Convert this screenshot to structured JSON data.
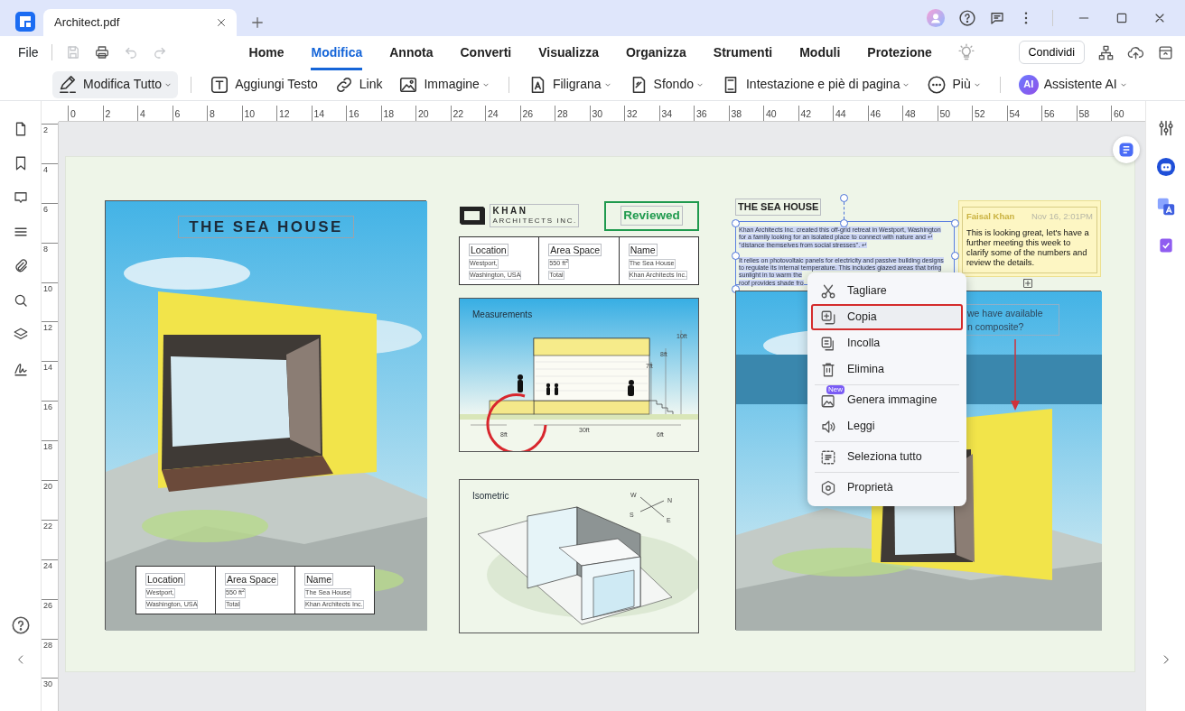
{
  "window": {
    "tab_title": "Architect.pdf"
  },
  "menu_bar": {
    "file": "File",
    "quick_actions": [
      {
        "disabled": true
      },
      {
        "disabled": false
      },
      {
        "disabled": true
      },
      {
        "disabled": true
      }
    ],
    "tabs": [
      {
        "label": "Home",
        "selected": false
      },
      {
        "label": "Modifica",
        "selected": true
      },
      {
        "label": "Annota",
        "selected": false
      },
      {
        "label": "Converti",
        "selected": false
      },
      {
        "label": "Visualizza",
        "selected": false
      },
      {
        "label": "Organizza",
        "selected": false
      },
      {
        "label": "Strumenti",
        "selected": false
      },
      {
        "label": "Moduli",
        "selected": false
      },
      {
        "label": "Protezione",
        "selected": false
      }
    ],
    "share_button": "Condividi"
  },
  "toolbar": [
    {
      "label": "Modifica Tutto",
      "dropdown": true,
      "selected": true,
      "separator_after": true
    },
    {
      "label": "Aggiungi Testo",
      "dropdown": false,
      "selected": false,
      "separator_after": false
    },
    {
      "label": "Link",
      "dropdown": false,
      "selected": false,
      "separator_after": false
    },
    {
      "label": "Immagine",
      "dropdown": true,
      "selected": false,
      "separator_after": true
    },
    {
      "label": "Filigrana",
      "dropdown": true,
      "selected": false,
      "separator_after": false
    },
    {
      "label": "Sfondo",
      "dropdown": true,
      "selected": false,
      "separator_after": false
    },
    {
      "label": "Intestazione e piè di pagina",
      "dropdown": true,
      "selected": false,
      "separator_after": false
    },
    {
      "label": "Più",
      "dropdown": true,
      "selected": false,
      "separator_after": true
    },
    {
      "label": "Assistente AI",
      "dropdown": true,
      "selected": false,
      "separator_after": false,
      "badge": "AI"
    }
  ],
  "ruler": {
    "horizontal": [
      "0",
      "2",
      "4",
      "6",
      "8",
      "10",
      "12",
      "14",
      "16",
      "18",
      "20",
      "22",
      "24",
      "26",
      "28",
      "30",
      "32",
      "34",
      "36",
      "38",
      "40",
      "42",
      "44",
      "46",
      "48",
      "50",
      "52",
      "54",
      "56",
      "58",
      "60"
    ],
    "vertical": [
      "2",
      "4",
      "6",
      "8",
      "10",
      "12",
      "14",
      "16",
      "18",
      "20",
      "22",
      "24",
      "26",
      "28",
      "30"
    ]
  },
  "document": {
    "left_panel": {
      "title": "THE SEA HOUSE",
      "info": [
        {
          "label": "Location",
          "lines": [
            "Westport,",
            "Washington, USA"
          ]
        },
        {
          "label": "Area Space",
          "lines": [
            "550 ft$^{2}$",
            "Total"
          ]
        },
        {
          "label": "Name",
          "lines": [
            "The Sea House",
            "Khan Architects Inc."
          ]
        }
      ]
    },
    "logo": {
      "name": "KHAN",
      "subtitle": "ARCHITECTS INC."
    },
    "stamp": "Reviewed",
    "info": [
      {
        "label": "Location",
        "lines": [
          "Westport,",
          "Washington, USA"
        ]
      },
      {
        "label": "Area Space",
        "lines": [
          "550 ft$^{2}$",
          "Total"
        ]
      },
      {
        "label": "Name",
        "lines": [
          "The Sea House",
          "Khan Architects Inc."
        ]
      }
    ],
    "measurements": {
      "title": "Measurements",
      "labels": [
        "10ft",
        "8ft",
        "7ft",
        "8ft",
        "30ft",
        "6ft"
      ]
    },
    "isometric": {
      "title": "Isometric",
      "compass": [
        "W",
        "N",
        "S",
        "E"
      ]
    },
    "right_panel": {
      "title": "THE SEA HOUSE",
      "paragraphs": [
        [
          "Khan Architects Inc. created this off-grid retreat in Westport, Washington",
          "for a family looking for an isolated place to connect with nature and ↵",
          "\"distance themselves from social stresses\". ↵"
        ],
        [
          "It relies on photovoltaic panels for electricity and passive building designs",
          "to regulate its internal temperature. This includes glazed areas that bring",
          "sunlight in to warm the",
          "roof provides shade fro"
        ]
      ],
      "callout": [
        "we have available",
        "n composite?"
      ]
    },
    "note": {
      "author": "Faisal Khan",
      "time": "Nov 16, 2:01PM",
      "text": "This is looking great, let's have a further meeting this week to clarify some of the numbers and review the details."
    }
  },
  "context_menu": [
    {
      "label": "Tagliare",
      "selected": false,
      "divider_after": false
    },
    {
      "label": "Copia",
      "selected": true,
      "divider_after": false
    },
    {
      "label": "Incolla",
      "selected": false,
      "divider_after": false
    },
    {
      "label": "Elimina",
      "selected": false,
      "divider_after": true
    },
    {
      "label": "Genera immagine",
      "selected": false,
      "divider_after": false,
      "badge": "New"
    },
    {
      "label": "Leggi",
      "selected": false,
      "divider_after": true
    },
    {
      "label": "Seleziona tutto",
      "selected": false,
      "divider_after": true
    },
    {
      "label": "Proprietà",
      "selected": false,
      "divider_after": false
    }
  ]
}
